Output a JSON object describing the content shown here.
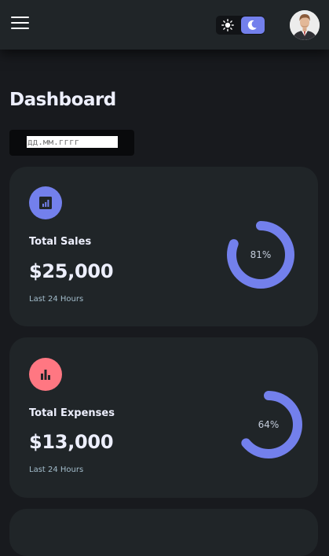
{
  "colors": {
    "background": "#181a1e",
    "surface": "#202528",
    "primary": "#7380ec",
    "danger": "#ff7782",
    "text": "#edeffd",
    "muted": "#a3bdcc"
  },
  "header": {
    "menu_icon": "hamburger-menu-icon",
    "theme_toggle": {
      "light_icon": "sun-icon",
      "dark_icon": "moon-icon",
      "active": "dark"
    },
    "avatar": "profile-photo"
  },
  "page": {
    "title": "Dashboard",
    "date_placeholder": "дд.мм.гггг"
  },
  "cards": [
    {
      "label": "Total Sales",
      "value": "$25,000",
      "subtitle": "Last 24 Hours",
      "percent_label": "81%",
      "percent": 81,
      "icon": "analytics-icon",
      "icon_color": "#7380ec"
    },
    {
      "label": "Total Expenses",
      "value": "$13,000",
      "subtitle": "Last 24 Hours",
      "percent_label": "64%",
      "percent": 64,
      "icon": "bar-chart-icon",
      "icon_color": "#ff7782"
    }
  ]
}
